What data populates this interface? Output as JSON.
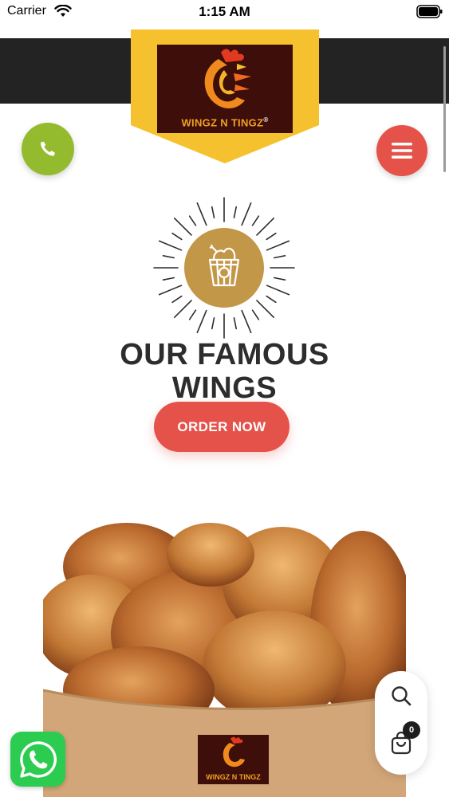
{
  "status_bar": {
    "carrier": "Carrier",
    "time": "1:15 AM",
    "icons": [
      "wifi-icon",
      "battery-icon"
    ]
  },
  "header": {
    "logo_text": "WINGZ N TINGZ",
    "logo_mark": "®",
    "colors": {
      "band": "#232323",
      "badge": "#f6c12f",
      "logo_bg": "#3d0e0a"
    }
  },
  "actions": {
    "call_icon": "phone-icon",
    "menu_icon": "hamburger-menu-icon"
  },
  "hero": {
    "emblem_icon": "wings-bucket-icon",
    "title_line1": "OUR FAMOUS",
    "title_line2": "WINGS",
    "cta_label": "ORDER NOW",
    "accent": "#e4524a"
  },
  "product_image": {
    "tray_label": "WINGZ N TINGZ"
  },
  "floating": {
    "search_icon": "search-icon",
    "cart_icon": "shopping-bag-icon",
    "cart_count": "0"
  },
  "whatsapp": {
    "icon": "whatsapp-icon",
    "color": "#2ccc50"
  }
}
